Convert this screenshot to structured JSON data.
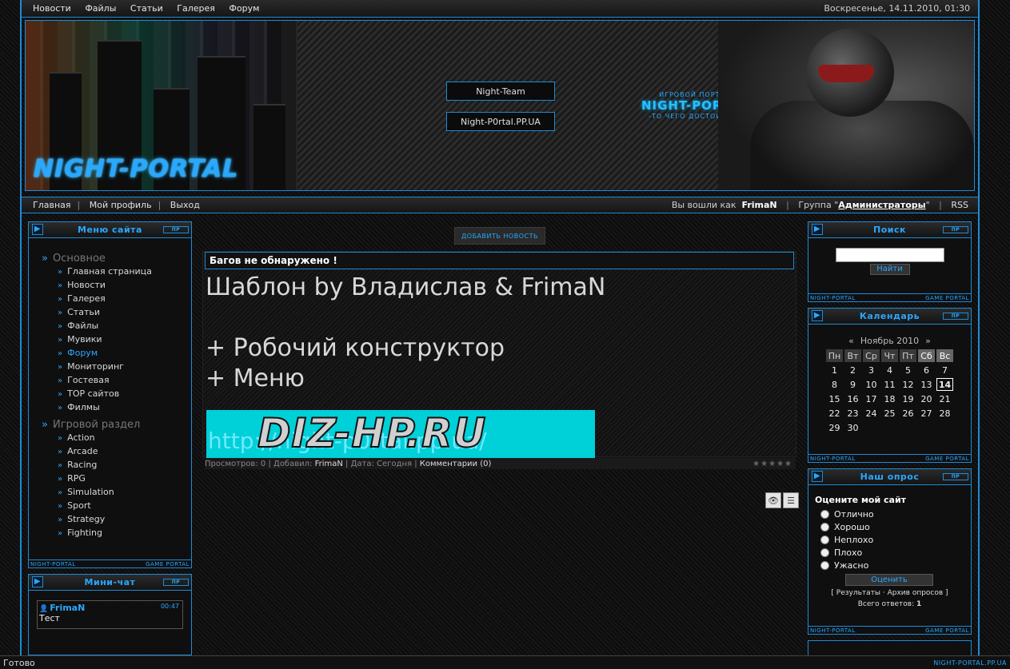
{
  "topnav": [
    "Новости",
    "Файлы",
    "Статьи",
    "Галерея",
    "Форум"
  ],
  "datetime": "Воскресенье, 14.11.2010, 01:30",
  "header": {
    "btn1": "Night-Team",
    "btn2": "Night-P0rtal.PP.UA",
    "tag_small": "ИГРОВОЙ ПОРТАЛ",
    "tag_big": "NIGHT-PORTAL",
    "tag_sub": "-ТО ЧЕГО ДОСТОИН ТЫ",
    "logo": "NIGHT-PORTAL"
  },
  "userbar": {
    "links": [
      "Главная",
      "Мой профиль",
      "Выход"
    ],
    "logged_prefix": "Вы вошли как",
    "username": "FrimaN",
    "group_prefix": "Группа \"",
    "group": "Администраторы",
    "group_suffix": "\"",
    "rss": "RSS"
  },
  "menu": {
    "title": "Меню сайта",
    "cat1": "Основное",
    "main_items": [
      "Главная страница",
      "Новости",
      "Галерея",
      "Статьи",
      "Файлы",
      "Мувики",
      "Форум",
      "Мониторинг",
      "Гостевая",
      "TOP сайтов",
      "Филмы"
    ],
    "cat2": "Игровой раздел",
    "game_items": [
      "Action",
      "Arcade",
      "Racing",
      "RPG",
      "Simulation",
      "Sport",
      "Strategy",
      "Fighting"
    ]
  },
  "block_footer": {
    "left": "NIGHT-PORTAL",
    "right": "GAME PORTAL"
  },
  "block_pr": "ПР",
  "chat": {
    "title": "Мини-чат",
    "user": "FrimaN",
    "time": "00:47",
    "text": "Тест"
  },
  "news": {
    "add_button": "ДОБАВИТЬ НОВОСТЬ",
    "title": "Багов не обнаружено !",
    "line1": "Шаблон by Владислав & FrimaN",
    "line2": "+ Робочий конструктор",
    "line3": "+ Меню",
    "banner_text": "DIZ-HP.RU",
    "banner_bg": "http://night-p0rtal.pp.ua/",
    "views_label": "Просмотров:",
    "views": "0",
    "added_label": "Добавил:",
    "author": "FrimaN",
    "date_label": "Дата:",
    "date": "Сегодня",
    "comments": "Комментарии (0)"
  },
  "search": {
    "title": "Поиск",
    "button": "Найти"
  },
  "calendar": {
    "title": "Календарь",
    "month": "Ноябрь 2010",
    "prev": "«",
    "next": "»",
    "days": [
      "Пн",
      "Вт",
      "Ср",
      "Чт",
      "Пт",
      "Сб",
      "Вс"
    ],
    "weeks": [
      [
        "1",
        "2",
        "3",
        "4",
        "5",
        "6",
        "7"
      ],
      [
        "8",
        "9",
        "10",
        "11",
        "12",
        "13",
        "14"
      ],
      [
        "15",
        "16",
        "17",
        "18",
        "19",
        "20",
        "21"
      ],
      [
        "22",
        "23",
        "24",
        "25",
        "26",
        "27",
        "28"
      ],
      [
        "29",
        "30",
        "",
        "",
        "",
        "",
        ""
      ]
    ],
    "today": "14"
  },
  "poll": {
    "title": "Наш опрос",
    "question": "Оцените мой сайт",
    "options": [
      "Отлично",
      "Хорошо",
      "Неплохо",
      "Плохо",
      "Ужасно"
    ],
    "vote_button": "Оценить",
    "results": "[ Результаты · Архив опросов ]",
    "total_label": "Всего ответов:",
    "total": "1"
  },
  "status": {
    "left": "Готово",
    "right": "NIGHT-PORTAL.PP.UA"
  },
  "colors": {
    "accent": "#1d8bd8",
    "glow": "#29a8ff",
    "banner": "#00d0d8"
  }
}
